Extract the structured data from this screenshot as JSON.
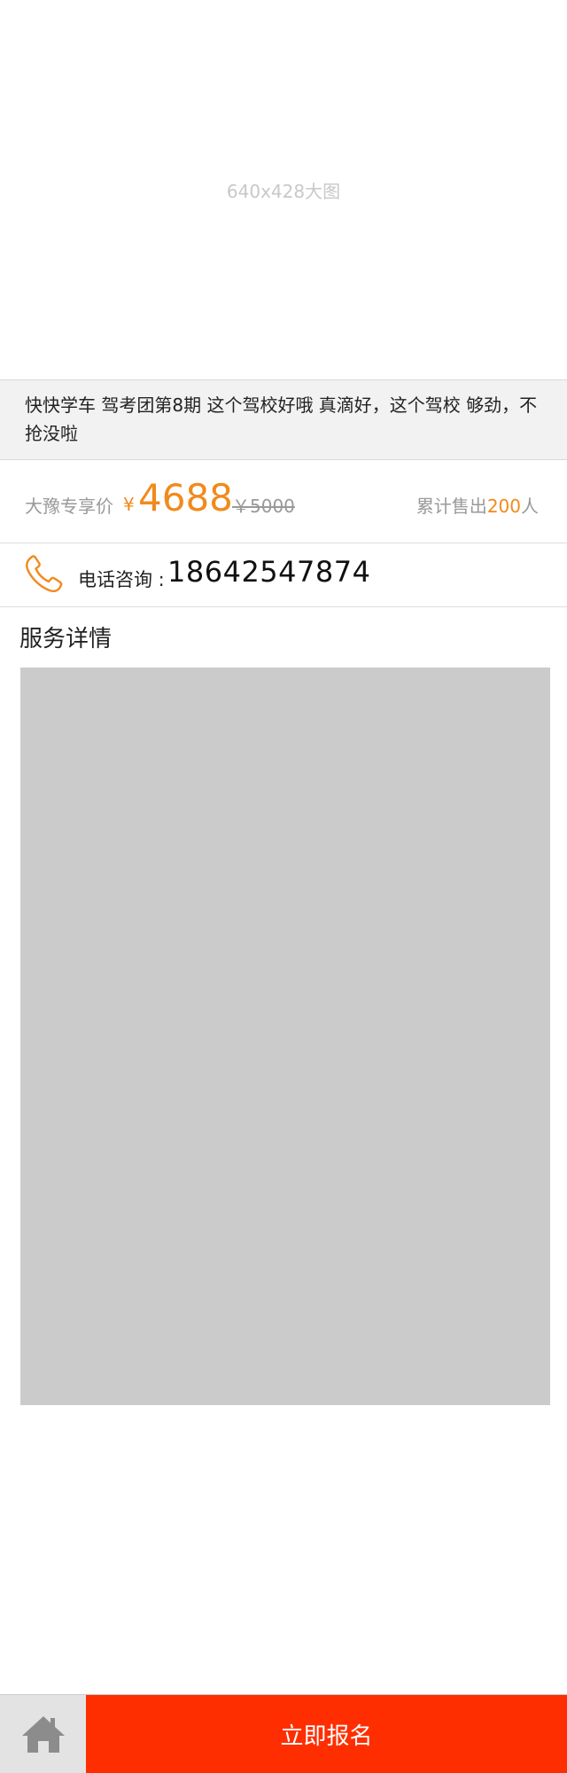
{
  "hero": {
    "image_label": "640x428大图"
  },
  "course": {
    "title": "快快学车 驾考团第8期 这个驾校好哦 真滴好，这个驾校 够劲，不抢没啦"
  },
  "price": {
    "label": "大豫专享价",
    "currency": "¥",
    "current": "4688",
    "original": "￥5000",
    "sold_prefix": "累计售出",
    "sold_count": "200",
    "sold_suffix": "人"
  },
  "contact": {
    "label": "电话咨询 :",
    "phone": "18642547874",
    "icon": "phone-icon"
  },
  "details": {
    "section_title": "服务详情"
  },
  "bottom_bar": {
    "home_icon": "home-icon",
    "signup_label": "立即报名"
  },
  "colors": {
    "accent_orange": "#f18a1c",
    "cta_red": "#ff2e00",
    "placeholder_gray": "#cbcbcb"
  }
}
